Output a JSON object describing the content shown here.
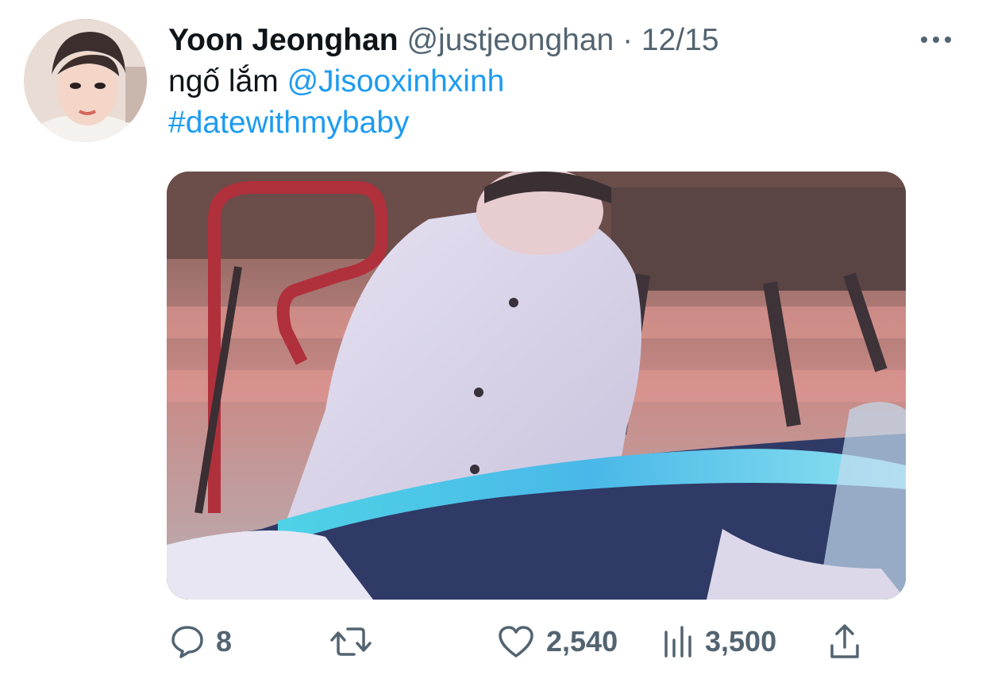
{
  "tweet": {
    "author_name": "Yoon Jeonghan",
    "author_handle": "@justjeonghan",
    "separator": "·",
    "date": "12/15",
    "text_plain": "ngố lắm ",
    "mention": "@Jisooxinhxinh",
    "hashtag": "#datewithmybaby"
  },
  "icons": {
    "more": "more-horizontal-icon",
    "reply": "reply-icon",
    "retweet": "retweet-icon",
    "like": "heart-icon",
    "views": "views-chart-icon",
    "share": "share-icon"
  },
  "actions": {
    "reply_count": "8",
    "retweet_count": "",
    "like_count": "2,540",
    "views_count": "3,500"
  },
  "colors": {
    "text": "#0f1419",
    "secondary": "#536471",
    "link": "#1d9bf0"
  }
}
